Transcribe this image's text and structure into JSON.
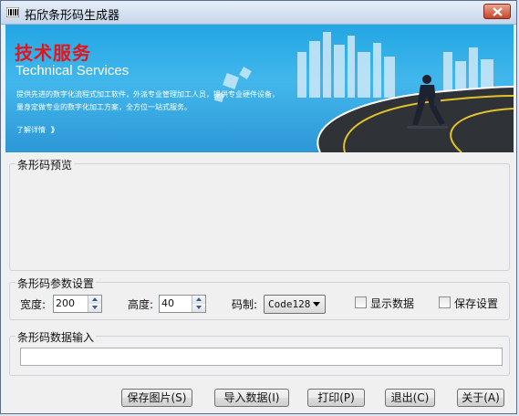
{
  "window": {
    "title": "拓欣条形码生成器"
  },
  "banner": {
    "title": "技术服务",
    "subtitle": "Technical Services",
    "line1": "提供先进的数字化流程式加工软件，外派专业管理加工人员，提供专业硬件设备，",
    "line2": "量身定做专业的数字化加工方案，全方位一站式服务。",
    "more": "了解详情",
    "more_arrow": "》"
  },
  "preview": {
    "title": "条形码预览"
  },
  "settings": {
    "title": "条形码参数设置",
    "width_label": "宽度:",
    "width_value": "200",
    "height_label": "高度:",
    "height_value": "40",
    "code_label": "码制:",
    "code_value": "Code128",
    "show_data_label": "显示数据",
    "save_settings_label": "保存设置"
  },
  "input": {
    "title": "条形码数据输入",
    "value": ""
  },
  "buttons": {
    "save_image": "保存图片(S)",
    "import_data": "导入数据(I)",
    "print": "打印(P)",
    "exit": "退出(C)",
    "about": "关于(A)"
  }
}
